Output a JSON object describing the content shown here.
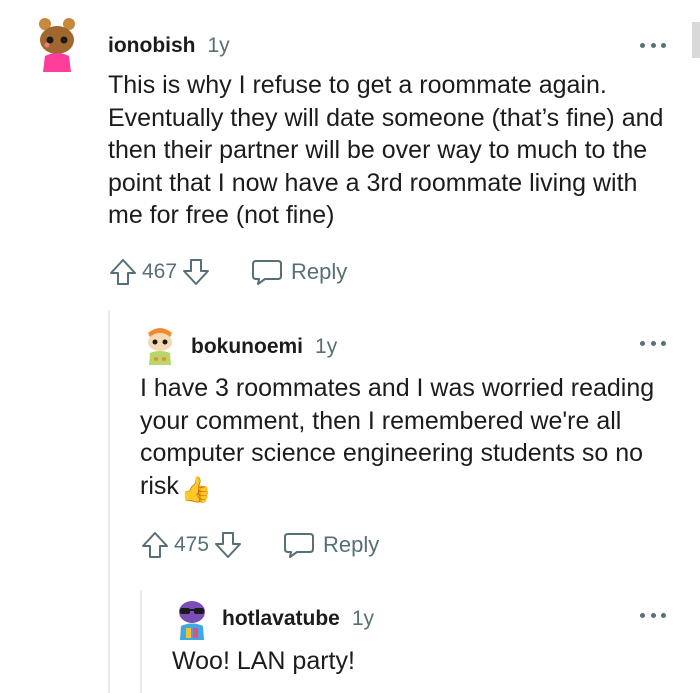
{
  "comments": [
    {
      "username": "ionobish",
      "age": "1y",
      "body": "This is why I refuse to get a roommate again. Eventually they will date someone (that’s fine) and then their partner will be over way to much to the point that I now have a 3rd roommate living with me for free (not fine)",
      "score": "467",
      "reply_label": "Reply",
      "avatar_icon": "snoo-avatar-buns-pink-icon"
    },
    {
      "username": "bokunoemi",
      "age": "1y",
      "body": "I have 3 roommates and I was worried reading your comment, then I remembered we're all computer science engineering students so no risk",
      "body_emoji": "👍",
      "score": "475",
      "reply_label": "Reply",
      "avatar_icon": "snoo-avatar-orange-hair-icon"
    },
    {
      "username": "hotlavatube",
      "age": "1y",
      "body": "Woo! LAN party!",
      "avatar_icon": "snoo-avatar-purple-sunglasses-icon"
    }
  ],
  "colors": {
    "text": "#1c1c1c",
    "meta": "#576f76",
    "thread_line": "#e5ebee",
    "thumbs_up": "#f5b52e"
  }
}
